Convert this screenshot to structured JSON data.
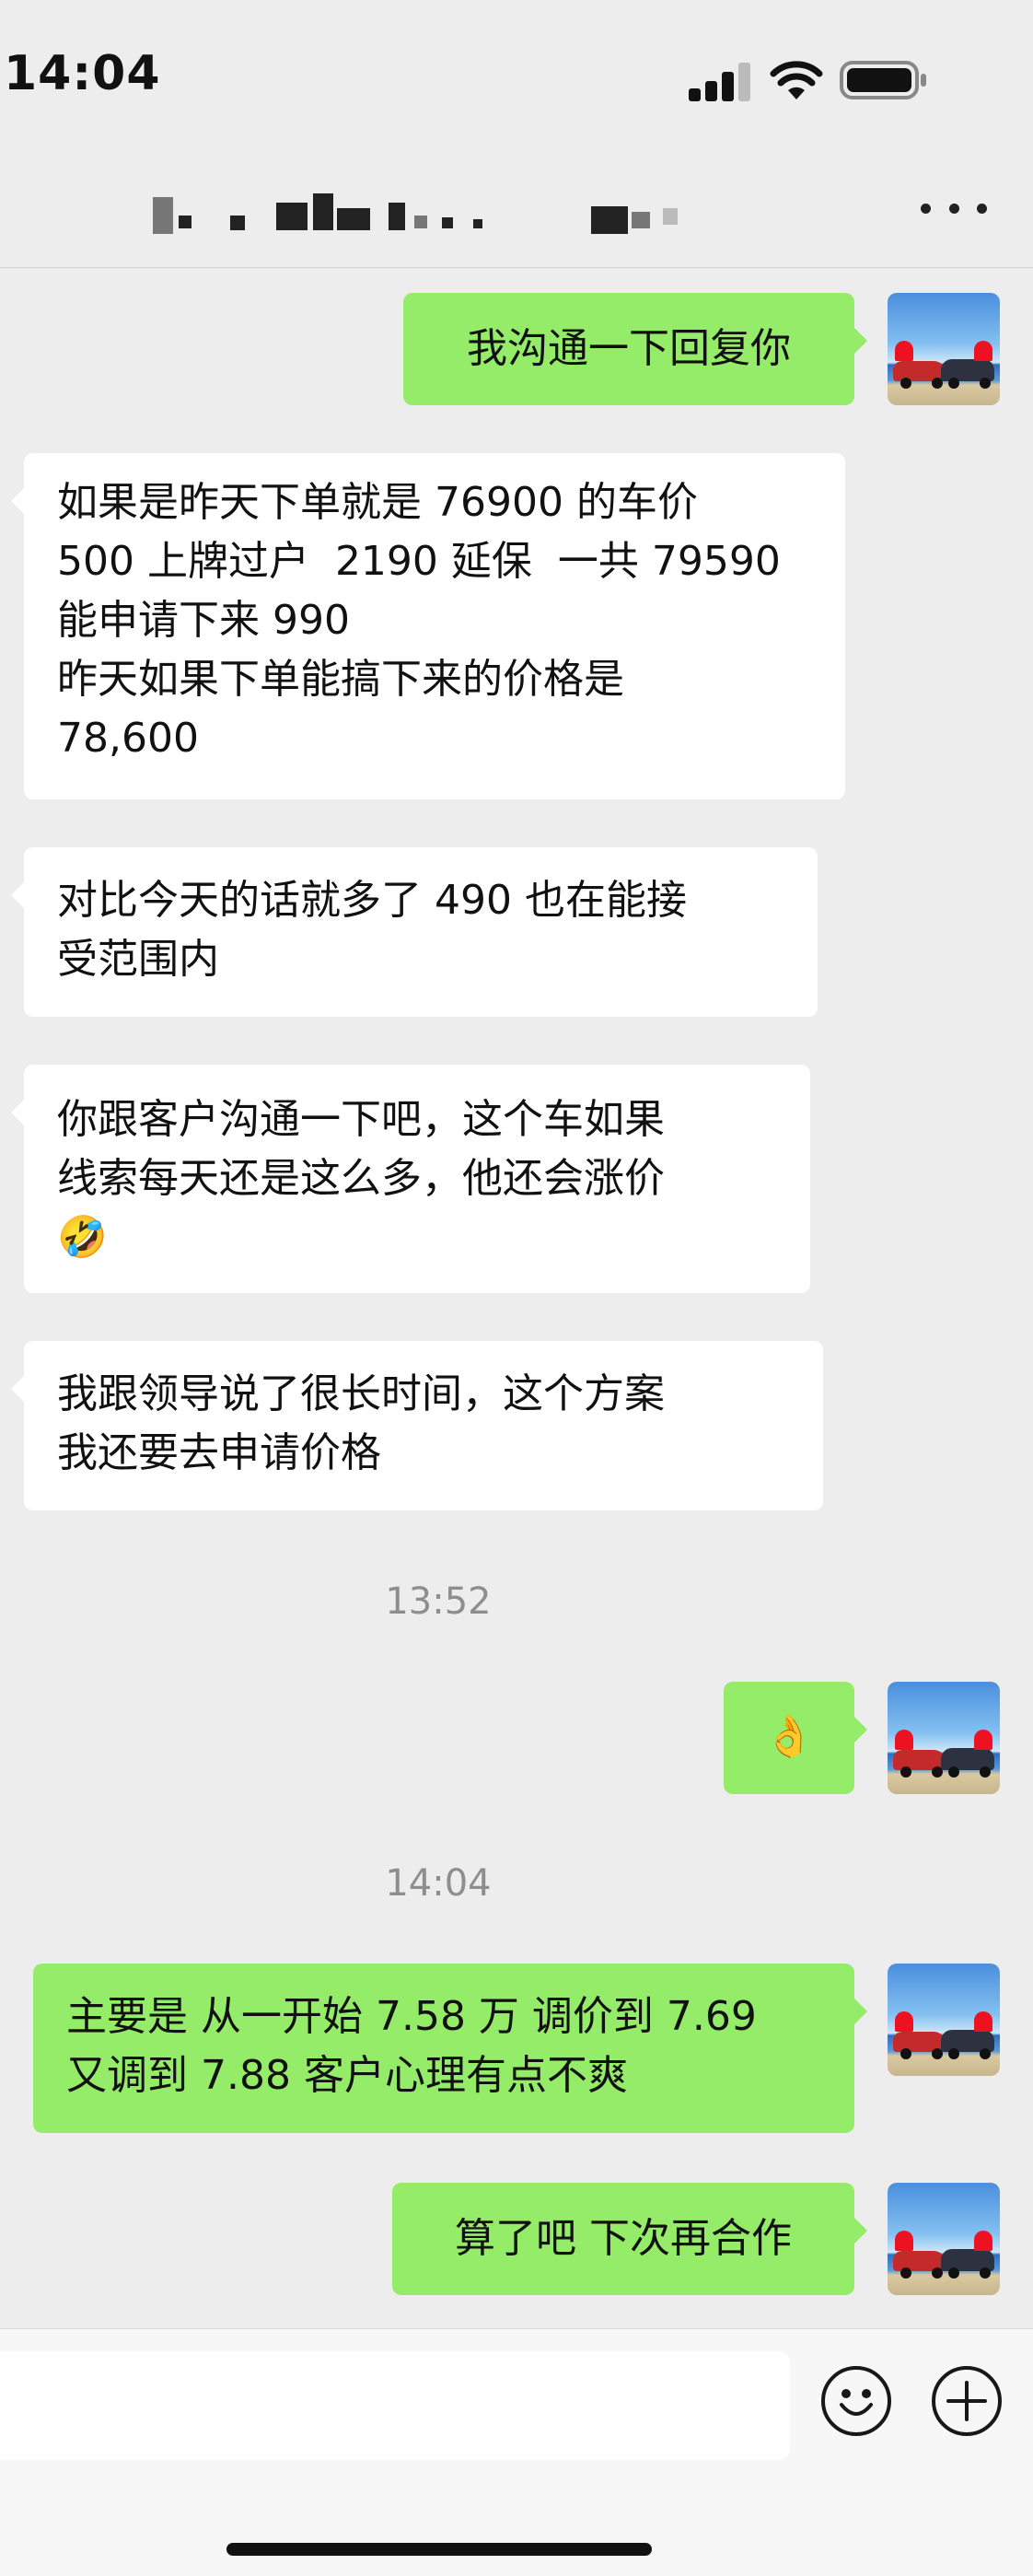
{
  "status_bar": {
    "time": "14:04"
  },
  "header": {
    "more_icon": "more-horizontal-icon"
  },
  "messages": [
    {
      "side": "out",
      "lines": [
        "我沟通一下回复你"
      ]
    },
    {
      "side": "in",
      "lines": [
        "如果是昨天下单就是 76900 的车价",
        "500 上牌过户  2190 延保  一共 79590",
        "能申请下来 990",
        "昨天如果下单能搞下来的价格是",
        "78,600"
      ]
    },
    {
      "side": "in",
      "lines": [
        "对比今天的话就多了 490 也在能接",
        "受范围内"
      ]
    },
    {
      "side": "in",
      "lines": [
        "你跟客户沟通一下吧，这个车如果",
        "线索每天还是这么多，他还会涨价",
        "🤣"
      ]
    },
    {
      "side": "in",
      "lines": [
        "我跟领导说了很长时间，这个方案",
        "我还要去申请价格"
      ]
    },
    {
      "side": "time",
      "text": "13:52"
    },
    {
      "side": "out",
      "lines": [
        "👌"
      ]
    },
    {
      "side": "time",
      "text": "14:04"
    },
    {
      "side": "out",
      "lines": [
        "主要是 从一开始 7.58 万 调价到 7.69",
        "又调到 7.88 客户心理有点不爽"
      ]
    },
    {
      "side": "out",
      "lines": [
        "算了吧 下次再合作"
      ]
    }
  ],
  "input_bar": {
    "emoji_icon": "smiley-icon",
    "add_icon": "plus-circle-icon",
    "accent": "#95ec69"
  }
}
